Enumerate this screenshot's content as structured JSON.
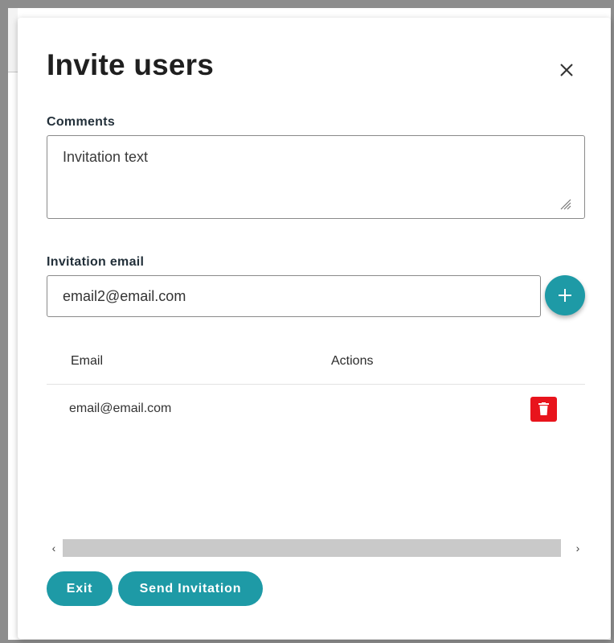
{
  "dialog": {
    "title": "Invite users",
    "close_icon": "close-icon"
  },
  "comments": {
    "label": "Comments",
    "value": "Invitation text"
  },
  "invitation_email": {
    "label": "Invitation email",
    "value": "email2@email.com",
    "add_icon": "plus-icon"
  },
  "table": {
    "columns": [
      "Email",
      "Actions"
    ],
    "rows": [
      {
        "email": "email@email.com",
        "action_icon": "trash-icon"
      }
    ]
  },
  "scrollbar": {
    "left_arrow": "‹",
    "right_arrow": "›"
  },
  "buttons": {
    "exit_label": "Exit",
    "send_label": "Send Invitation"
  },
  "colors": {
    "accent": "#1e9aa6",
    "danger": "#e8141c"
  }
}
